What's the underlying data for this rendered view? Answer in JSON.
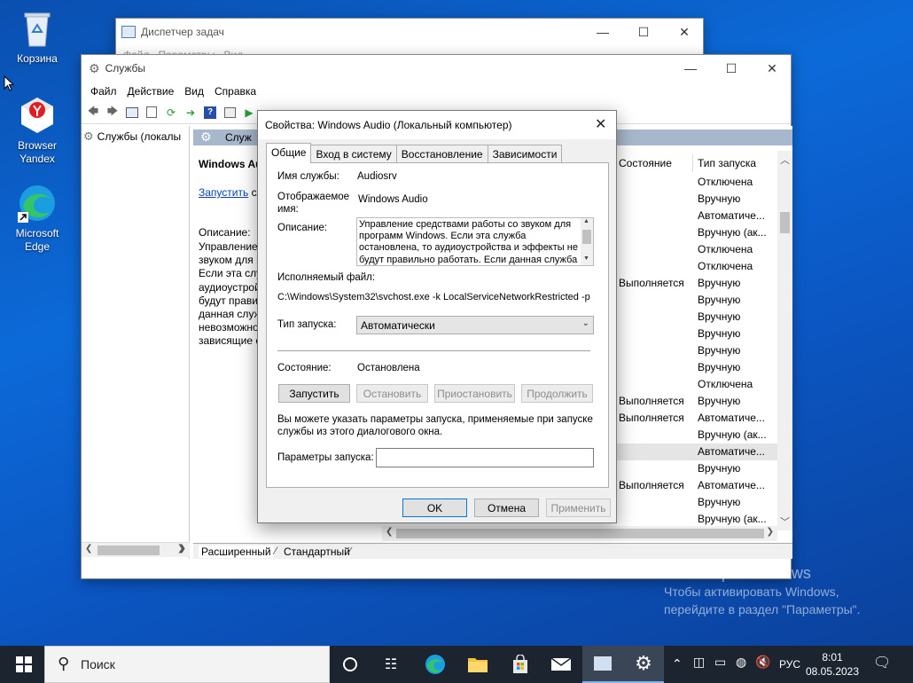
{
  "desktop": {
    "recycle_bin": "Корзина",
    "yandex_line1": "Browser",
    "yandex_line2": "Yandex",
    "edge_line1": "Microsoft",
    "edge_line2": "Edge"
  },
  "task_manager": {
    "title": "Диспетчер задач",
    "menu_partial": "Файл   Параметры   Вид"
  },
  "services_window": {
    "title": "Службы",
    "menu": [
      "Файл",
      "Действие",
      "Вид",
      "Справка"
    ],
    "tree_item": "Службы (локалы",
    "header_partial": "Служ",
    "selected_name": "Windows Audi",
    "start_link": "Запустить",
    "start_link_rest": "сл",
    "desc_label": "Описание:",
    "desc_lines": [
      "Управление",
      "звуком для п",
      "Если эта слу",
      "аудиоустрой",
      "будут правил.",
      "данная служ",
      "невозможно",
      "зависящие с"
    ],
    "col_state": "Состояние",
    "col_start": "Тип запуска",
    "states": [
      "",
      "",
      "",
      "",
      "",
      "",
      "Выполняется",
      "",
      "",
      "",
      "",
      "",
      "",
      "Выполняется",
      "Выполняется",
      "",
      "",
      "",
      "Выполняется",
      "",
      ""
    ],
    "start_types": [
      "Отключена",
      "Вручную",
      "Автоматиче...",
      "Вручную (ак...",
      "Отключена",
      "Отключена",
      "Вручную",
      "Вручную",
      "Вручную",
      "Вручную",
      "Вручную",
      "Вручную",
      "Отключена",
      "Вручную",
      "Автоматиче...",
      "Вручную (ак...",
      "Автоматиче...",
      "Вручную",
      "Автоматиче...",
      "Вручную",
      "Вручную (ак..."
    ],
    "tab_extended": "Расширенный",
    "tab_standard": "Стандартный"
  },
  "dialog": {
    "title": "Свойства: Windows Audio (Локальный компьютер)",
    "tabs": [
      "Общие",
      "Вход в систему",
      "Восстановление",
      "Зависимости"
    ],
    "service_name_label": "Имя службы:",
    "service_name": "Audiosrv",
    "display_name_label_1": "Отображаемое",
    "display_name_label_2": "имя:",
    "display_name": "Windows Audio",
    "description_label": "Описание:",
    "description": "Управление средствами работы со звуком для программ Windows.  Если эта служба остановлена, то аудиоустройства и эффекты не будут правильно работать.  Если данная служба",
    "exe_label": "Исполняемый файл:",
    "exe_path": "C:\\Windows\\System32\\svchost.exe -k LocalServiceNetworkRestricted -p",
    "startup_type_label": "Тип запуска:",
    "startup_type": "Автоматически",
    "status_label": "Состояние:",
    "status": "Остановлена",
    "btn_start": "Запустить",
    "btn_stop": "Остановить",
    "btn_pause": "Приостановить",
    "btn_resume": "Продолжить",
    "hint_1": "Вы можете указать параметры запуска, применяемые при запуске",
    "hint_2": "службы из этого диалогового окна.",
    "params_label": "Параметры запуска:",
    "params_value": "",
    "ok": "OK",
    "cancel": "Отмена",
    "apply": "Применить"
  },
  "watermark": {
    "line1": "Активация Windows",
    "line2": "Чтобы активировать Windows,",
    "line3": "перейдите в раздел \"Параметры\"."
  },
  "taskbar": {
    "search": "Поиск",
    "lang": "РУС",
    "time": "8:01",
    "date": "08.05.2023"
  }
}
